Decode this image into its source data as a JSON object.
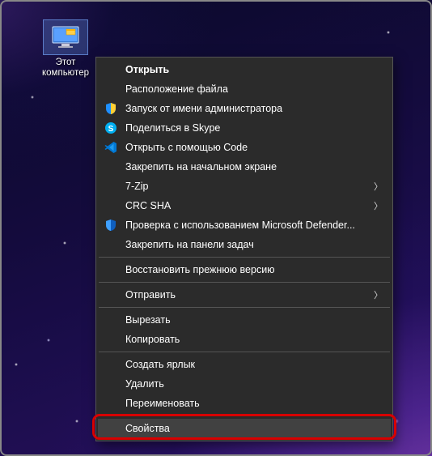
{
  "desktop": {
    "icon_label": "Этот\nкомпьютер"
  },
  "menu": {
    "open": "Открыть",
    "file_location": "Расположение файла",
    "run_as_admin": "Запуск от имени администратора",
    "share_skype": "Поделиться в Skype",
    "open_with_code": "Открыть с помощью Code",
    "pin_to_start": "Закрепить на начальном экране",
    "seven_zip": "7-Zip",
    "crc_sha": "CRC SHA",
    "defender_scan": "Проверка с использованием Microsoft Defender...",
    "pin_to_taskbar": "Закрепить на панели задач",
    "restore_previous": "Восстановить прежнюю версию",
    "send_to": "Отправить",
    "cut": "Вырезать",
    "copy": "Копировать",
    "create_shortcut": "Создать ярлык",
    "delete": "Удалить",
    "rename": "Переименовать",
    "properties": "Свойства"
  }
}
